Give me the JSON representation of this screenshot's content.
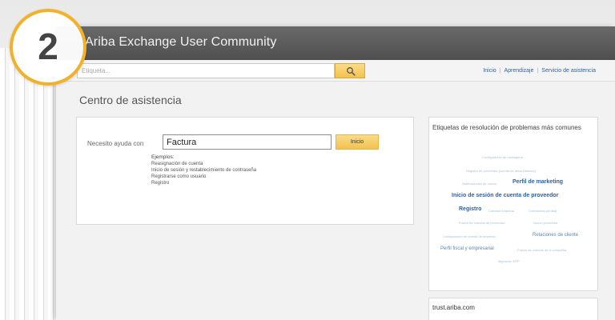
{
  "window": {
    "title": "Ariba Exchange User Community"
  },
  "toolbar": {
    "search_placeholder": "Etiqueta...",
    "nav": [
      "Inicio",
      "Aprendizaje",
      "Servicio de asistencia"
    ]
  },
  "page": {
    "title": "Centro de asistencia"
  },
  "help": {
    "label": "Necesito ayuda con",
    "value": "Factura",
    "submit_label": "Inicio",
    "examples_title": "Ejemplos:",
    "examples": [
      "Reasignación de cuenta",
      "Inicio de sesión y restablecimiento de contraseña",
      "Registrarse como usuario",
      "Registro"
    ]
  },
  "tags": {
    "title": "Etiquetas de resolución de problemas más comunes",
    "items": [
      {
        "label": "Configuración de mensajería",
        "weight": 1
      },
      {
        "label": "Registro de proveedor (cuenta de Ariba Network)",
        "weight": 1
      },
      {
        "label": "Notificaciones de correo",
        "weight": 1
      },
      {
        "label": "Perfil de marketing",
        "weight": 3
      },
      {
        "label": "Inicio de sesión de cuenta de proveedor",
        "weight": 3
      },
      {
        "label": "Registro",
        "weight": 3
      },
      {
        "label": "Cambiar empresa",
        "weight": 1
      },
      {
        "label": "Contraseña perdida",
        "weight": 1
      },
      {
        "label": "Fusión de cuentas de proveedor",
        "weight": 1
      },
      {
        "label": "Nuevo proveedor",
        "weight": 1
      },
      {
        "label": "Configuración de cuenta de empresa",
        "weight": 1
      },
      {
        "label": "Relaciones de cliente",
        "weight": 2
      },
      {
        "label": "Perfil fiscal y empresarial",
        "weight": 2
      },
      {
        "label": "Fusión de cuentas de la compañía",
        "weight": 1
      },
      {
        "label": "Migración ERP",
        "weight": 1
      }
    ]
  },
  "trust": {
    "title": "trust.ariba.com"
  },
  "step_badge": {
    "number": "2",
    "ring_color": "#f2b12a"
  },
  "colors": {
    "accent_button": "#f2c24e",
    "link": "#2a62a8",
    "titlebar": "#5a5a5a"
  },
  "icons": {
    "search_button": "magnifier-icon"
  }
}
